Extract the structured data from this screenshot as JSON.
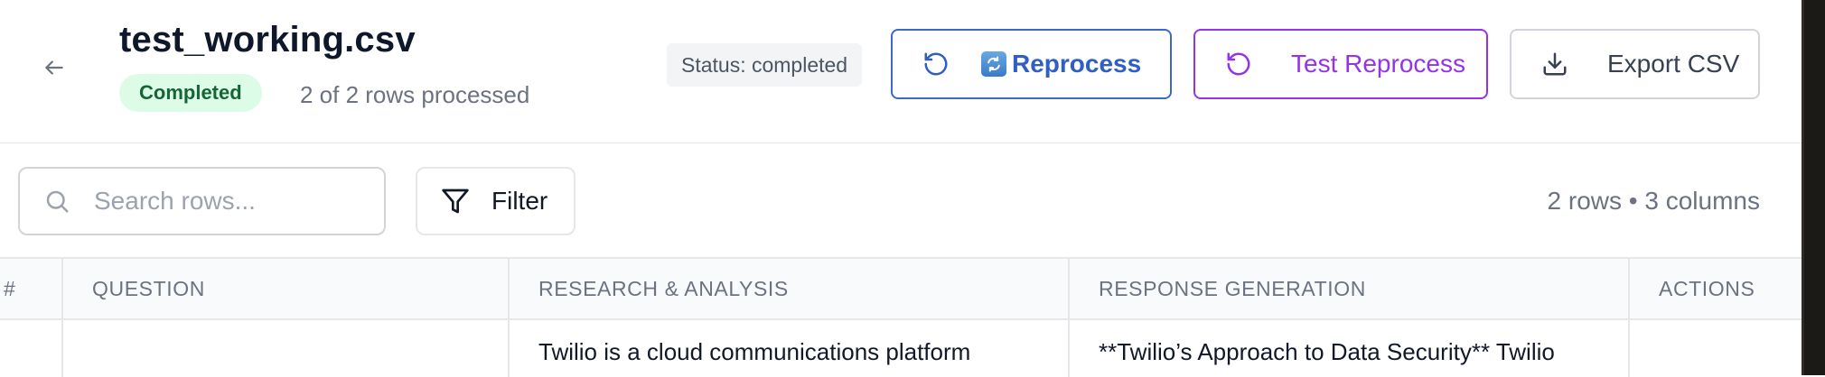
{
  "header": {
    "title": "test_working.csv",
    "status_badge": "Completed",
    "rows_processed": "2 of 2 rows processed",
    "status_text": "Status: completed",
    "buttons": {
      "reprocess": "Reprocess",
      "test_reprocess": "Test Reprocess",
      "export_csv": "Export CSV"
    }
  },
  "toolbar": {
    "search_placeholder": "Search rows...",
    "search_value": "",
    "filter_label": "Filter",
    "row_count": "2 rows • 3 columns"
  },
  "table": {
    "columns": [
      "#",
      "QUESTION",
      "RESEARCH & ANALYSIS",
      "RESPONSE GENERATION",
      "ACTIONS"
    ],
    "rows": [
      {
        "index": "",
        "question": "",
        "research": "Twilio is a cloud communications platform",
        "response": "**Twilio’s Approach to Data Security** Twilio",
        "actions": ""
      }
    ]
  },
  "colors": {
    "primary_blue": "#2f5fc4",
    "purple": "#9333ea",
    "success_bg": "#dcfce7",
    "success_text": "#166534",
    "muted_text": "#6b7280",
    "border": "#e5e7eb"
  },
  "icons": {
    "back": "arrow-left-icon",
    "reprocess": "rotate-ccw-icon",
    "emoji": "arrows-counterclockwise-emoji",
    "test_reprocess": "rotate-ccw-icon",
    "export": "download-icon",
    "search": "search-icon",
    "filter": "funnel-icon"
  }
}
